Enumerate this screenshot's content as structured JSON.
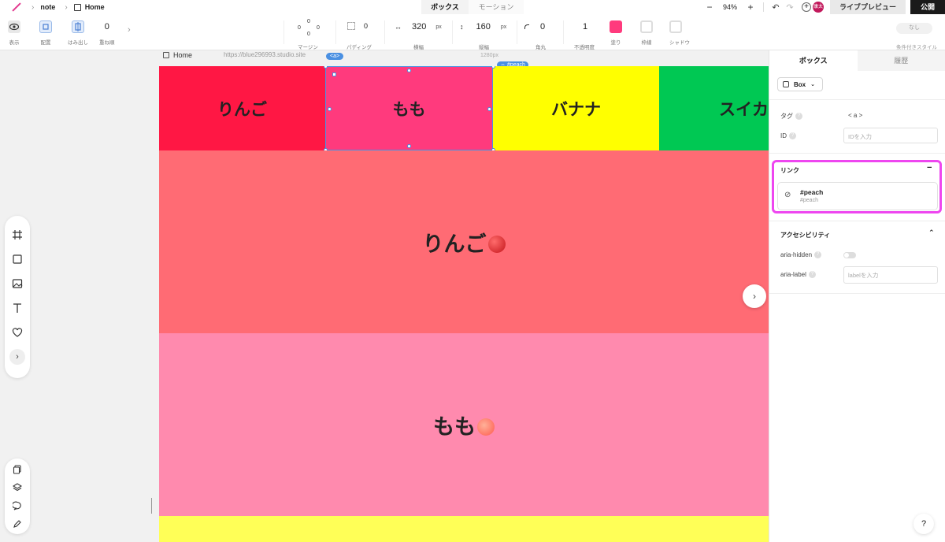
{
  "topbar": {
    "breadcrumb": [
      "note",
      "Home"
    ],
    "tabs": [
      "ボックス",
      "モーション"
    ],
    "zoom_minus": "−",
    "zoom": "94%",
    "zoom_plus": "+",
    "avatar_text": "康太",
    "live_preview": "ライブプレビュー",
    "publish": "公開",
    "colors": {
      "publish_bg": "#1a1a1a",
      "avatar_bg": "#c2185b",
      "brand": "#e33a8f"
    }
  },
  "toolbar": {
    "view_label": "表示",
    "layout_label": "配置",
    "overflow_label": "はみ出し",
    "zindex_value": "0",
    "zindex_label": "重ね順",
    "margin": {
      "top": "0",
      "left": "0",
      "right": "0",
      "bottom": "0",
      "label": "マージン"
    },
    "padding": {
      "value": "0",
      "label": "パディング"
    },
    "width": {
      "value": "320",
      "unit": "px",
      "label": "横幅"
    },
    "height": {
      "value": "160",
      "unit": "px",
      "label": "縦幅"
    },
    "radius": {
      "value": "0",
      "label": "角丸"
    },
    "opacity": {
      "value": "1",
      "label": "不透明度"
    },
    "fill": {
      "label": "塗り",
      "color": "#ff3a7d"
    },
    "border_label": "枠線",
    "shadow_label": "シャドウ",
    "conditional_value": "なし",
    "conditional_label": "条件付きスタイル"
  },
  "canvas": {
    "page_name": "Home",
    "url": "https://blue296993.studio.site",
    "breakpoint": "1280px",
    "selected_tag": "<a>",
    "link_badge": "#peach",
    "nav": [
      {
        "label": "りんご",
        "color": "#ff1744"
      },
      {
        "label": "もも",
        "color": "#ff3a7d"
      },
      {
        "label": "バナナ",
        "color": "#ffff00"
      },
      {
        "label": "スイカ",
        "color": "#00c853"
      }
    ],
    "sections": [
      {
        "label": "りんご",
        "emoji": "apple",
        "color": "#ff6b74"
      },
      {
        "label": "もも",
        "emoji": "peach",
        "color": "#ff8aae"
      },
      {
        "label": "",
        "emoji": "",
        "color": "#ffff57"
      }
    ]
  },
  "inspector": {
    "tabs": [
      "ボックス",
      "履歴"
    ],
    "element_type": "Box",
    "tag_label": "タグ",
    "tag_value": "< a >",
    "id_label": "ID",
    "id_placeholder": "IDを入力",
    "link_section": "リンク",
    "link_collapse": "−",
    "link_title": "#peach",
    "link_sub": "#peach",
    "a11y_section": "アクセシビリティ",
    "aria_hidden_label": "aria-hidden",
    "aria_label_label": "aria-label",
    "aria_label_placeholder": "labelを入力",
    "highlight_color": "#ee46f0"
  },
  "help_button": "?"
}
